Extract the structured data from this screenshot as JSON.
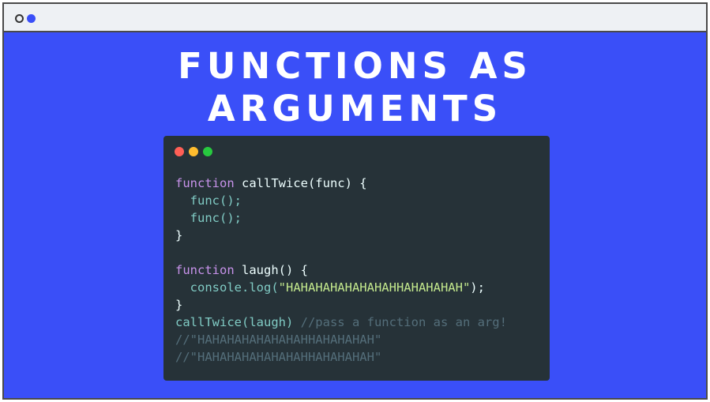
{
  "window": {
    "dot_icons": [
      "circle-outline-icon",
      "circle-filled-icon"
    ]
  },
  "title": {
    "line1": "FUNCTIONS AS",
    "line2": "ARGUMENTS"
  },
  "code_window": {
    "traffic_lights": [
      "red",
      "yellow",
      "green"
    ],
    "colors": {
      "red": "#ff5f56",
      "yellow": "#ffbd2e",
      "green": "#27c93f"
    },
    "lines": {
      "l1_kw": "function",
      "l1_rest": " callTwice(func) {",
      "l2": "  func();",
      "l3": "  func();",
      "l4": "}",
      "l6_kw": "function",
      "l6_rest": " laugh() {",
      "l7_a": "  console.log(",
      "l7_str": "\"HAHAHAHAHAHAHAHHAHAHAHAH\"",
      "l7_b": ");",
      "l8": "}",
      "l9_a": "callTwice(laugh) ",
      "l9_com": "//pass a function as an arg!",
      "l10": "//\"HAHAHAHAHAHAHAHHAHAHAHAH\"",
      "l11": "//\"HAHAHAHAHAHAHAHHAHAHAHAH\""
    }
  },
  "colors": {
    "background": "#3a4ff8",
    "code_bg": "#263238",
    "keyword": "#c792ea",
    "call": "#80cbc4",
    "string": "#c3e88d",
    "comment": "#546e7a"
  }
}
